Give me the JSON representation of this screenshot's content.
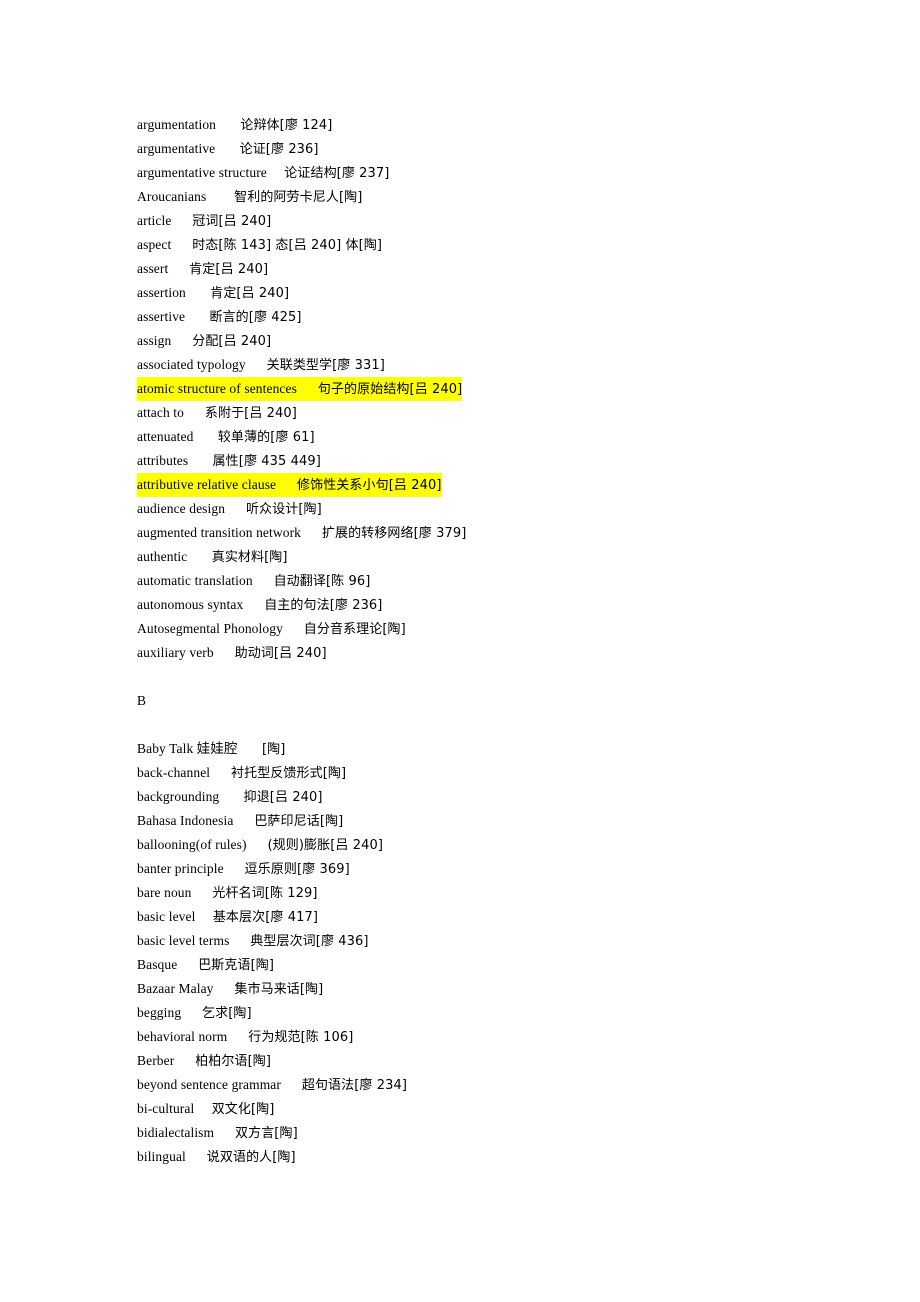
{
  "document": {
    "type": "bilingual-glossary-page",
    "highlight_color": "#ffff00",
    "page_background": "#ffffff",
    "text_color": "#000000"
  },
  "entries": [
    {
      "en": "argumentation",
      "zh": "论辩体[廖 124]",
      "gap": 7,
      "highlight": false
    },
    {
      "en": "argumentative",
      "zh": "论证[廖 236]",
      "gap": 7,
      "highlight": false
    },
    {
      "en": "argumentative structure",
      "zh": "论证结构[廖 237]",
      "gap": 5,
      "highlight": false
    },
    {
      "en": "Aroucanians",
      "zh": "智利的阿劳卡尼人[陶]",
      "gap": 8,
      "highlight": false
    },
    {
      "en": "article",
      "zh": "冠词[吕 240]",
      "gap": 6,
      "highlight": false
    },
    {
      "en": "aspect",
      "zh": "时态[陈 143] 态[吕 240] 体[陶]",
      "gap": 6,
      "highlight": false
    },
    {
      "en": "assert",
      "zh": "肯定[吕 240]",
      "gap": 6,
      "highlight": false
    },
    {
      "en": "assertion",
      "zh": "肯定[吕 240]",
      "gap": 7,
      "highlight": false
    },
    {
      "en": "assertive",
      "zh": "断言的[廖 425]",
      "gap": 7,
      "highlight": false
    },
    {
      "en": "assign",
      "zh": "分配[吕 240]",
      "gap": 6,
      "highlight": false
    },
    {
      "en": "associated typology",
      "zh": "关联类型学[廖 331]",
      "gap": 6,
      "highlight": false
    },
    {
      "en": "atomic structure of sentences",
      "zh": "句子的原始结构[吕 240]",
      "gap": 6,
      "highlight": true
    },
    {
      "en": "attach to",
      "zh": "系附于[吕 240]",
      "gap": 6,
      "highlight": false
    },
    {
      "en": "attenuated",
      "zh": "较单薄的[廖 61]",
      "gap": 7,
      "highlight": false
    },
    {
      "en": "attributes",
      "zh": "属性[廖 435 449]",
      "gap": 7,
      "highlight": false
    },
    {
      "en": "attributive relative clause",
      "zh": "修饰性关系小句[吕 240]",
      "gap": 6,
      "highlight": true
    },
    {
      "en": "audience design",
      "zh": "听众设计[陶]",
      "gap": 6,
      "highlight": false
    },
    {
      "en": "augmented transition network",
      "zh": "扩展的转移网络[廖 379]",
      "gap": 6,
      "highlight": false
    },
    {
      "en": "authentic",
      "zh": "真实材料[陶]",
      "gap": 7,
      "highlight": false
    },
    {
      "en": "automatic translation",
      "zh": "自动翻译[陈 96]",
      "gap": 6,
      "highlight": false
    },
    {
      "en": "autonomous syntax",
      "zh": "自主的句法[廖 236]",
      "gap": 6,
      "highlight": false
    },
    {
      "en": "Autosegmental Phonology",
      "zh": "自分音系理论[陶]",
      "gap": 6,
      "highlight": false
    },
    {
      "en": "auxiliary verb",
      "zh": "助动词[吕 240]",
      "gap": 6,
      "highlight": false
    },
    {
      "blank": true
    },
    {
      "letter": "B"
    },
    {
      "blank": true
    },
    {
      "en": "Baby Talk 娃娃腔",
      "zh": "[陶]",
      "gap": 7,
      "highlight": false
    },
    {
      "en": "back-channel",
      "zh": "衬托型反馈形式[陶]",
      "gap": 6,
      "highlight": false
    },
    {
      "en": "backgrounding",
      "zh": "抑退[吕 240]",
      "gap": 7,
      "highlight": false
    },
    {
      "en": "Bahasa Indonesia",
      "zh": "巴萨印尼话[陶]",
      "gap": 6,
      "highlight": false
    },
    {
      "en": "ballooning(of rules)",
      "zh": "(规则)膨胀[吕 240]",
      "gap": 6,
      "highlight": false
    },
    {
      "en": "banter principle",
      "zh": "逗乐原则[廖 369]",
      "gap": 6,
      "highlight": false
    },
    {
      "en": "bare noun",
      "zh": "光杆名词[陈 129]",
      "gap": 6,
      "highlight": false
    },
    {
      "en": "basic level",
      "zh": "基本层次[廖 417]",
      "gap": 5,
      "highlight": false
    },
    {
      "en": "basic level terms",
      "zh": "典型层次词[廖 436]",
      "gap": 6,
      "highlight": false
    },
    {
      "en": "Basque",
      "zh": "巴斯克语[陶]",
      "gap": 6,
      "highlight": false
    },
    {
      "en": "Bazaar Malay",
      "zh": "集市马来话[陶]",
      "gap": 6,
      "highlight": false
    },
    {
      "en": "begging",
      "zh": "乞求[陶]",
      "gap": 6,
      "highlight": false
    },
    {
      "en": "behavioral norm",
      "zh": "行为规范[陈 106]",
      "gap": 6,
      "highlight": false
    },
    {
      "en": "Berber",
      "zh": "柏柏尔语[陶]",
      "gap": 6,
      "highlight": false
    },
    {
      "en": "beyond sentence grammar",
      "zh": "超句语法[廖 234]",
      "gap": 6,
      "highlight": false
    },
    {
      "en": "bi-cultural",
      "zh": "双文化[陶]",
      "gap": 5,
      "highlight": false
    },
    {
      "en": "bidialectalism",
      "zh": "双方言[陶]",
      "gap": 6,
      "highlight": false
    },
    {
      "en": "bilingual",
      "zh": "说双语的人[陶]",
      "gap": 6,
      "highlight": false
    }
  ]
}
